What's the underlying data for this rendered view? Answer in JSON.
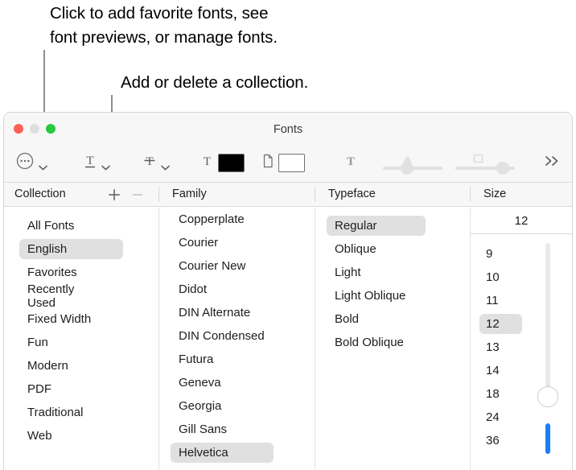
{
  "annotations": [
    {
      "id": "callout-1",
      "text_line_1": "Click to add favorite fonts, see",
      "text_line_2": "font previews, or manage fonts."
    },
    {
      "id": "callout-2",
      "text": "Add or delete a collection."
    }
  ],
  "callout_1_line_1": "Click to add favorite fonts, see",
  "callout_1_line_2": "font previews, or manage fonts.",
  "callout_2_line_1": "Add or delete a collection.",
  "window": {
    "title": "Fonts",
    "traffic_lights": [
      {
        "name": "close",
        "color": "#ff5f57"
      },
      {
        "name": "minimize",
        "color": "#dedede"
      },
      {
        "name": "zoom",
        "color": "#28c840"
      }
    ]
  },
  "toolbar": {
    "items": [
      {
        "name": "action-menu",
        "icon": "ellipsis-circle-icon",
        "has_chevron": true
      },
      {
        "name": "underline",
        "icon": "underline-T-icon",
        "has_chevron": true
      },
      {
        "name": "strikethrough",
        "icon": "strikethrough-T-icon",
        "has_chevron": true
      },
      {
        "name": "text-color",
        "icon": "T-icon",
        "swatch": "#000000"
      },
      {
        "name": "document-color",
        "icon": "page-icon",
        "swatch": "#ffffff"
      },
      {
        "name": "text-shadow-toggle",
        "icon": "bold-T-icon"
      },
      {
        "name": "shadow-opacity-slider",
        "icon": "triangle-marker",
        "value": 50
      },
      {
        "name": "shadow-blur-slider",
        "icon": "square-marker",
        "value": 82
      },
      {
        "name": "overflow",
        "icon": "double-chevron-right-icon"
      }
    ],
    "overflow_label": "»"
  },
  "columns": {
    "headers": [
      {
        "key": "collection",
        "label": "Collection"
      },
      {
        "key": "family",
        "label": "Family"
      },
      {
        "key": "typeface",
        "label": "Typeface"
      },
      {
        "key": "size",
        "label": "Size"
      }
    ],
    "add_button_label": "+",
    "remove_button_label": "–"
  },
  "collection": {
    "items": [
      {
        "label": "All Fonts",
        "selected": false
      },
      {
        "label": "English",
        "selected": true
      },
      {
        "label": "Favorites",
        "selected": false
      },
      {
        "label": "Recently Used",
        "selected": false
      },
      {
        "label": "Fixed Width",
        "selected": false
      },
      {
        "label": "Fun",
        "selected": false
      },
      {
        "label": "Modern",
        "selected": false
      },
      {
        "label": "PDF",
        "selected": false
      },
      {
        "label": "Traditional",
        "selected": false
      },
      {
        "label": "Web",
        "selected": false
      }
    ]
  },
  "family": {
    "items": [
      {
        "label": "Copperplate",
        "selected": false
      },
      {
        "label": "Courier",
        "selected": false
      },
      {
        "label": "Courier New",
        "selected": false
      },
      {
        "label": "Didot",
        "selected": false
      },
      {
        "label": "DIN Alternate",
        "selected": false
      },
      {
        "label": "DIN Condensed",
        "selected": false
      },
      {
        "label": "Futura",
        "selected": false
      },
      {
        "label": "Geneva",
        "selected": false
      },
      {
        "label": "Georgia",
        "selected": false
      },
      {
        "label": "Gill Sans",
        "selected": false
      },
      {
        "label": "Helvetica",
        "selected": true
      }
    ]
  },
  "typeface": {
    "items": [
      {
        "label": "Regular",
        "selected": true
      },
      {
        "label": "Oblique",
        "selected": false
      },
      {
        "label": "Light",
        "selected": false
      },
      {
        "label": "Light Oblique",
        "selected": false
      },
      {
        "label": "Bold",
        "selected": false
      },
      {
        "label": "Bold Oblique",
        "selected": false
      }
    ]
  },
  "size": {
    "value": "12",
    "items": [
      {
        "label": "9",
        "selected": false
      },
      {
        "label": "10",
        "selected": false
      },
      {
        "label": "11",
        "selected": false
      },
      {
        "label": "12",
        "selected": true
      },
      {
        "label": "13",
        "selected": false
      },
      {
        "label": "14",
        "selected": false
      },
      {
        "label": "18",
        "selected": false
      },
      {
        "label": "24",
        "selected": false
      },
      {
        "label": "36",
        "selected": false
      }
    ],
    "slider_accent": "#1a7ef5"
  }
}
